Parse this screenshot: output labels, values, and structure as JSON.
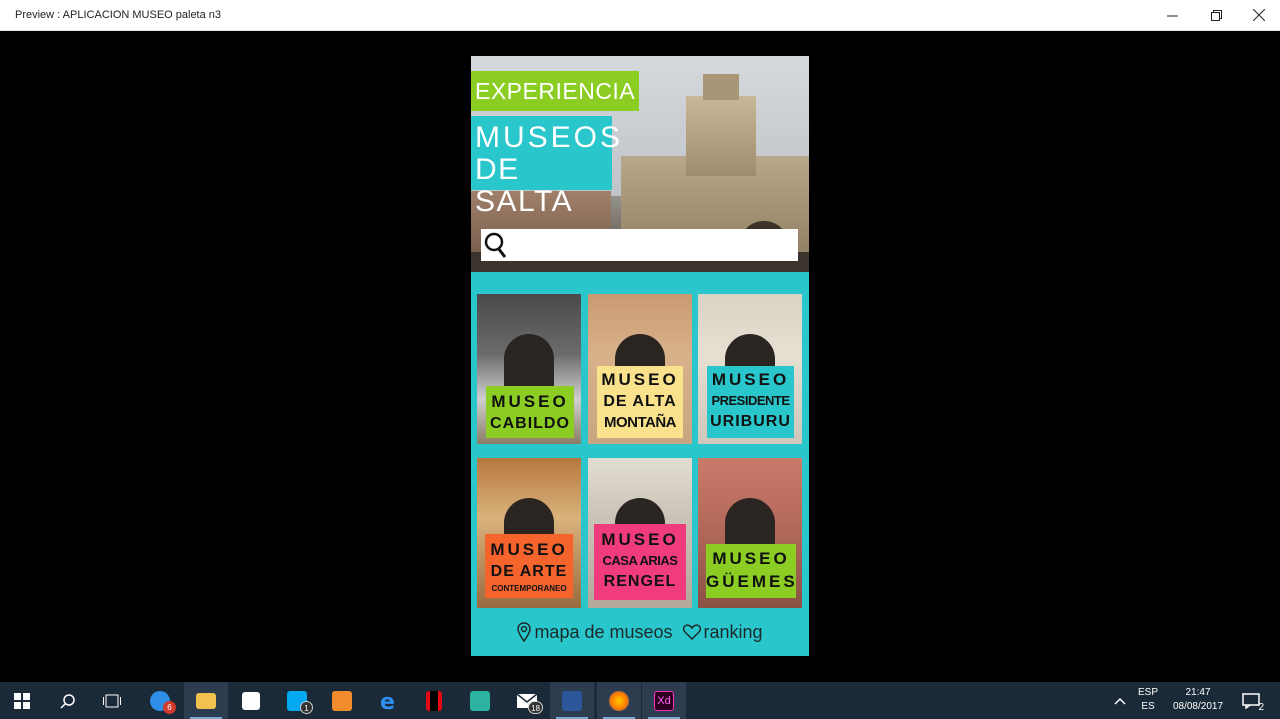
{
  "window": {
    "title": "Preview : APLICACION MUSEO paleta n3",
    "minimize_icon": "minimize-icon",
    "maximize_icon": "restore-icon",
    "close_icon": "close-icon"
  },
  "app": {
    "header": {
      "line1": "EXPERIENCIA",
      "line2a": "MUSEOS",
      "line2b": "DE SALTA"
    },
    "search": {
      "placeholder": "",
      "value": ""
    },
    "museums": [
      {
        "lines": [
          "MUSEO",
          "CABILDO"
        ],
        "color": "#8ccd23"
      },
      {
        "lines": [
          "MUSEO",
          "DE ALTA",
          "MONTAÑA"
        ],
        "color": "#f9e28b"
      },
      {
        "lines": [
          "MUSEO",
          "PRESIDENTE",
          "URIBURU"
        ],
        "color": "#29c6cc"
      },
      {
        "lines": [
          "MUSEO",
          "DE ARTE",
          "CONTEMPORANEO"
        ],
        "color": "#f5642d"
      },
      {
        "lines": [
          "MUSEO",
          "CASA ARIAS",
          "RENGEL"
        ],
        "color": "#f03c7c"
      },
      {
        "lines": [
          "MUSEO",
          "GÜEMES"
        ],
        "color": "#8ccd23"
      }
    ],
    "footer": {
      "map_label": "mapa de museos",
      "ranking_label": "ranking"
    },
    "colors": {
      "background": "#29c6cc",
      "accent_green": "#8ccd23"
    }
  },
  "taskbar": {
    "apps": [
      {
        "name": "start",
        "icon": "windows-icon"
      },
      {
        "name": "search",
        "icon": "search-icon"
      },
      {
        "name": "task-view",
        "icon": "task-view-icon"
      },
      {
        "name": "app-6",
        "icon": "app-icon",
        "badge": "6"
      },
      {
        "name": "file-explorer",
        "icon": "folder-icon"
      },
      {
        "name": "store",
        "icon": "store-icon"
      },
      {
        "name": "skype",
        "icon": "skype-icon",
        "badge": "1"
      },
      {
        "name": "media",
        "icon": "media-icon"
      },
      {
        "name": "edge",
        "icon": "edge-icon"
      },
      {
        "name": "netflix",
        "icon": "netflix-icon"
      },
      {
        "name": "health",
        "icon": "plus-icon"
      },
      {
        "name": "mail",
        "icon": "mail-icon",
        "badge": "18"
      },
      {
        "name": "word",
        "icon": "word-icon"
      },
      {
        "name": "firefox",
        "icon": "firefox-icon"
      },
      {
        "name": "xd",
        "icon": "xd-icon",
        "label": "Xd"
      }
    ],
    "lang_line1": "ESP",
    "lang_line2": "ES",
    "time": "21:47",
    "date": "08/08/2017",
    "notification_count": "2"
  }
}
